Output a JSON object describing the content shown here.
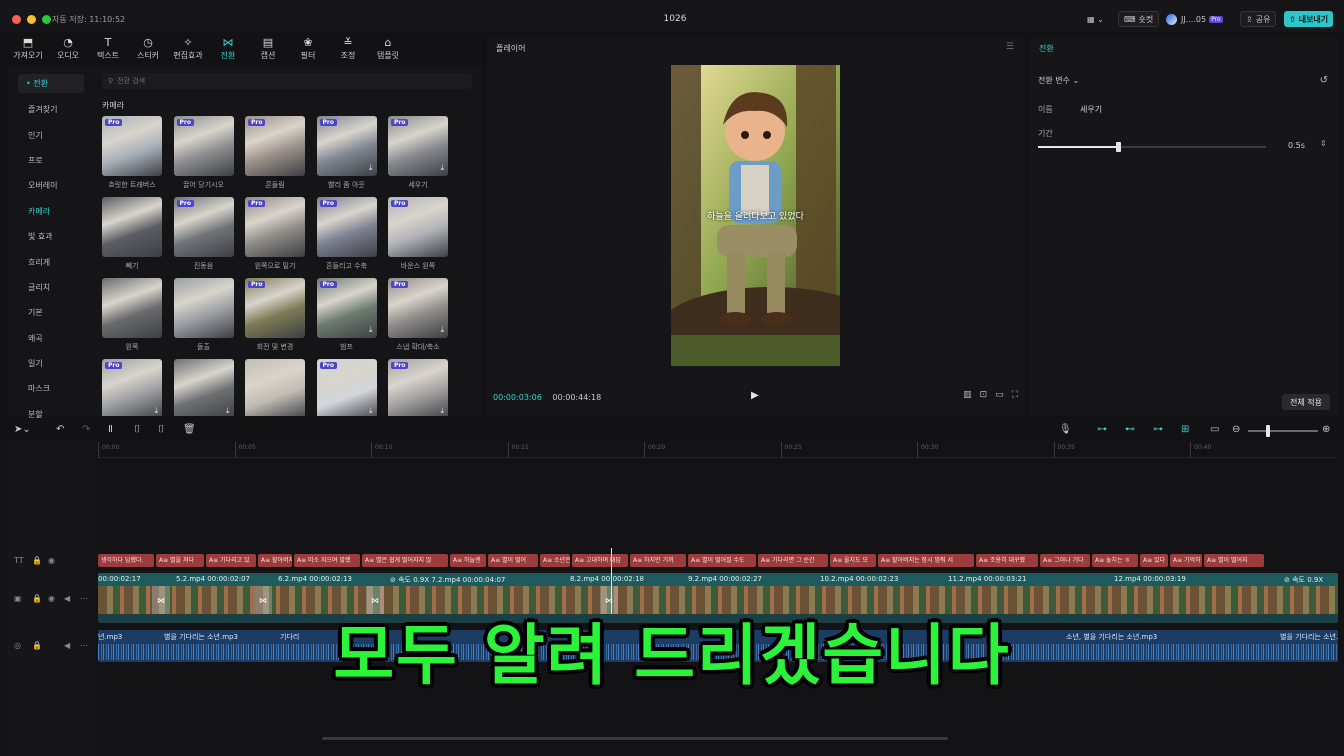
{
  "titlebar": {
    "save_status": "자동 저장: 11:10:52",
    "title": "1026",
    "shortcut_label": "숏컷",
    "account_label": "JJ....05",
    "pro_label": "Pro",
    "share_label": "공유",
    "export_label": "내보내기"
  },
  "toolbar": [
    {
      "label": "가져오기",
      "icon": "import-icon",
      "glyph": "⬒"
    },
    {
      "label": "오디오",
      "icon": "audio-icon",
      "glyph": "◔"
    },
    {
      "label": "텍스트",
      "icon": "text-icon",
      "glyph": "T"
    },
    {
      "label": "스티커",
      "icon": "sticker-icon",
      "glyph": "◷"
    },
    {
      "label": "편집효과",
      "icon": "effects-icon",
      "glyph": "✧"
    },
    {
      "label": "전환",
      "icon": "transition-icon",
      "glyph": "⋈",
      "active": true
    },
    {
      "label": "캡션",
      "icon": "caption-icon",
      "glyph": "▤"
    },
    {
      "label": "필터",
      "icon": "filter-icon",
      "glyph": "❀"
    },
    {
      "label": "조정",
      "icon": "adjust-icon",
      "glyph": "≚"
    },
    {
      "label": "템플릿",
      "icon": "template-icon",
      "glyph": "⌂"
    }
  ],
  "categories": {
    "selected": "• 전환",
    "items": [
      "즐겨찾기",
      "인기",
      "프로",
      "오버레이",
      "카메라",
      "빛 효과",
      "흐리게",
      "글리치",
      "기본",
      "왜곡",
      "일기",
      "마스크",
      "분할"
    ],
    "active_index": 4
  },
  "search": {
    "placeholder": "전환 검색"
  },
  "section_title": "카메라",
  "thumbnails": [
    {
      "label": "흐릿한 트래버스",
      "pro": true,
      "download": false,
      "color": "#a9b0b8"
    },
    {
      "label": "끌어 당기시오",
      "pro": true,
      "download": false,
      "color": "#8d8d90"
    },
    {
      "label": "흔들림",
      "pro": true,
      "download": false,
      "color": "#9a8f88"
    },
    {
      "label": "빨리 줌 아웃",
      "pro": true,
      "download": true,
      "color": "#7f8591"
    },
    {
      "label": "세우기",
      "pro": true,
      "download": true,
      "color": "#86888e"
    },
    {
      "label": "빼기",
      "pro": false,
      "download": false,
      "color": "#5b5d62"
    },
    {
      "label": "진동음",
      "pro": true,
      "download": false,
      "color": "#6f7377"
    },
    {
      "label": "왼쪽으로 밀기",
      "pro": true,
      "download": false,
      "color": "#8e8a86"
    },
    {
      "label": "흔들리고 수축",
      "pro": true,
      "download": false,
      "color": "#7c8090"
    },
    {
      "label": "바운스 왼쪽",
      "pro": true,
      "download": false,
      "color": "#b2b3b8"
    },
    {
      "label": "왼쪽",
      "pro": false,
      "download": false,
      "color": "#6a6a6d"
    },
    {
      "label": "돌출",
      "pro": false,
      "download": false,
      "color": "#9b9ea3"
    },
    {
      "label": "회전 및 변경",
      "pro": true,
      "download": false,
      "color": "#7d7a55"
    },
    {
      "label": "범프",
      "pro": true,
      "download": true,
      "color": "#6c7a6f"
    },
    {
      "label": "스냅 확대/축소",
      "pro": true,
      "download": true,
      "color": "#8e8b88"
    },
    {
      "label": "",
      "pro": true,
      "download": true,
      "color": "#9fa0a4"
    },
    {
      "label": "",
      "pro": false,
      "download": true,
      "color": "#6e6f73"
    },
    {
      "label": "",
      "pro": false,
      "download": false,
      "color": "#c2bdb4"
    },
    {
      "label": "",
      "pro": true,
      "download": true,
      "color": "#d2d5da"
    },
    {
      "label": "",
      "pro": true,
      "download": true,
      "color": "#a3a0a0"
    }
  ],
  "player": {
    "title": "플레이어",
    "subtitle": "하늘을 올려다보고 있었다",
    "current_time": "00:00:03:06",
    "total_time": "00:00:44:18"
  },
  "inspector": {
    "title": "전환",
    "section": "전환 변수 ⌄",
    "name_label": "이름",
    "name_value": "세우기",
    "duration_label": "기간",
    "duration_value": "0.5s",
    "duration_fraction": 0.35,
    "apply_all_label": "전체 적용"
  },
  "ruler_ticks": [
    "00:00",
    "00:05",
    "00:10",
    "00:15",
    "00:20",
    "00:25",
    "00:30",
    "00:35",
    "00:40"
  ],
  "text_clips": [
    {
      "label": "생각하다 답했다.",
      "w": 56
    },
    {
      "label": "A≡ 별을 쳐다",
      "w": 48
    },
    {
      "label": "A≡ 기다리고 있",
      "w": 50
    },
    {
      "label": "A≡ 할아버지",
      "w": 34
    },
    {
      "label": "A≡ 미소 지으며 말했",
      "w": 66
    },
    {
      "label": "A≡ 별은 쉽게 떨어지지 않",
      "w": 86
    },
    {
      "label": "A≡ 하늘엔",
      "w": 36
    },
    {
      "label": "A≡ 별이 떨어",
      "w": 50
    },
    {
      "label": "A≡ 소년은",
      "w": 30
    },
    {
      "label": "A≡ 고대하며 대답",
      "w": 56
    },
    {
      "label": "A≡ 하지만 기꺼",
      "w": 56
    },
    {
      "label": "A≡ 별이 떨어질 수도",
      "w": 68
    },
    {
      "label": "A≡ 기다리면 그 순간",
      "w": 70
    },
    {
      "label": "A≡ 울지도 모",
      "w": 46
    },
    {
      "label": "A≡ 할아버지는 잠시 멈춰 서",
      "w": 96
    },
    {
      "label": "A≡ 조용히 대꾸했",
      "w": 62
    },
    {
      "label": "A≡ 그러나 기다",
      "w": 50
    },
    {
      "label": "A≡ 놓치는 ㅎ",
      "w": 46
    },
    {
      "label": "A≡ 있다",
      "w": 28
    },
    {
      "label": "A≡ 기억하",
      "w": 32
    },
    {
      "label": "A≡ 별이 떨어지",
      "w": 60
    }
  ],
  "video_clips": [
    {
      "label": "00:00:02:17"
    },
    {
      "label": "5.2.mp4  00:00:02:07"
    },
    {
      "label": "6.2.mp4  00:00:02:13"
    },
    {
      "label": "⊘ 속도 0.9X  7.2.mp4  00:00:04:07"
    },
    {
      "label": "8.2.mp4  00:00:02:18"
    },
    {
      "label": "9.2.mp4  00:00:02:27"
    },
    {
      "label": "10.2.mp4  00:00:02:23"
    },
    {
      "label": "11.2.mp4  00:00:03:21"
    },
    {
      "label": "12.mp4  00:00:03:19"
    },
    {
      "label": "⊘ 속도 0.9X"
    }
  ],
  "audio_clips": [
    {
      "label": "년.mp3"
    },
    {
      "label": "별을 기다리는 소년.mp3"
    },
    {
      "label": "기다리"
    },
    {
      "label": "소년, 별을 기다리는 소년.mp3"
    },
    {
      "label": "별을 기다리는 소년."
    }
  ],
  "big_caption": "모두 알려 드리겠습니다"
}
